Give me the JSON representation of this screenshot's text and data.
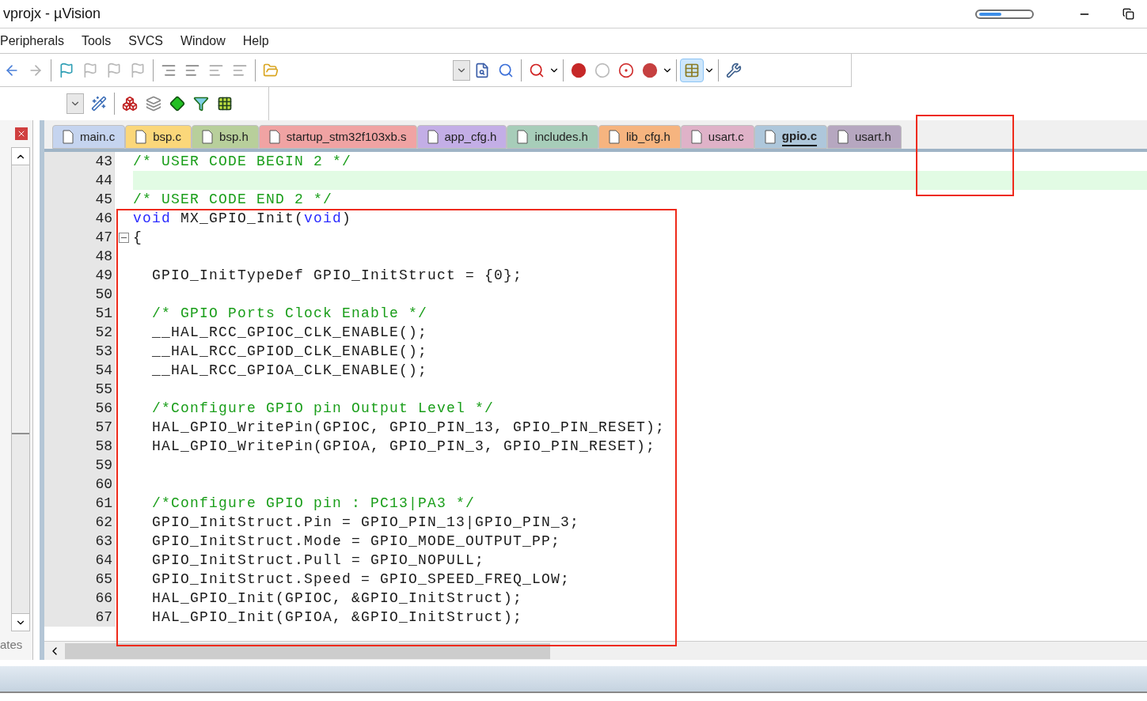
{
  "window": {
    "title": "vprojx - µVision"
  },
  "menu": [
    "Peripherals",
    "Tools",
    "SVCS",
    "Window",
    "Help"
  ],
  "left_panel": {
    "tab": "ates"
  },
  "tabs": [
    {
      "label": "main.c",
      "color": "#c5d4ef",
      "selected": false
    },
    {
      "label": "bsp.c",
      "color": "#fbd77a",
      "selected": false
    },
    {
      "label": "bsp.h",
      "color": "#b8cf9b",
      "selected": false
    },
    {
      "label": "startup_stm32f103xb.s",
      "color": "#f0a3a3",
      "selected": false
    },
    {
      "label": "app_cfg.h",
      "color": "#c3aee6",
      "selected": false
    },
    {
      "label": "includes.h",
      "color": "#a7cdb9",
      "selected": false
    },
    {
      "label": "lib_cfg.h",
      "color": "#f6b47f",
      "selected": false
    },
    {
      "label": "usart.c",
      "color": "#dfb2c8",
      "selected": false
    },
    {
      "label": "gpio.c",
      "color": "#aec7db",
      "selected": true
    },
    {
      "label": "usart.h",
      "color": "#b6a7c0",
      "selected": false
    }
  ],
  "code_lines": [
    {
      "number": "43",
      "highlighted": false,
      "fold": false,
      "segments": [
        {
          "kind": "comment",
          "text": "/* USER CODE BEGIN 2 */"
        }
      ]
    },
    {
      "number": "44",
      "highlighted": true,
      "fold": false
    },
    {
      "number": "45",
      "highlighted": false,
      "fold": false,
      "segments": [
        {
          "kind": "comment",
          "text": "/* USER CODE END 2 */"
        }
      ]
    },
    {
      "number": "46",
      "highlighted": false,
      "fold": false,
      "segments": [
        {
          "kind": "keyword",
          "text": "void"
        },
        {
          "kind": "plain",
          "text": " MX_GPIO_Init("
        },
        {
          "kind": "keyword",
          "text": "void"
        },
        {
          "kind": "plain",
          "text": ")"
        }
      ]
    },
    {
      "number": "47",
      "highlighted": false,
      "fold": true,
      "segments": [
        {
          "kind": "plain",
          "text": "{"
        }
      ]
    },
    {
      "number": "48",
      "highlighted": false,
      "fold": false
    },
    {
      "number": "49",
      "highlighted": false,
      "fold": false,
      "segments": [
        {
          "kind": "plain",
          "text": "  GPIO_InitTypeDef GPIO_InitStruct = {0};"
        }
      ]
    },
    {
      "number": "50",
      "highlighted": false,
      "fold": false
    },
    {
      "number": "51",
      "highlighted": false,
      "fold": false,
      "segments": [
        {
          "kind": "comment",
          "text": "  /* GPIO Ports Clock Enable */"
        }
      ]
    },
    {
      "number": "52",
      "highlighted": false,
      "fold": false,
      "segments": [
        {
          "kind": "plain",
          "text": "  __HAL_RCC_GPIOC_CLK_ENABLE();"
        }
      ]
    },
    {
      "number": "53",
      "highlighted": false,
      "fold": false,
      "segments": [
        {
          "kind": "plain",
          "text": "  __HAL_RCC_GPIOD_CLK_ENABLE();"
        }
      ]
    },
    {
      "number": "54",
      "highlighted": false,
      "fold": false,
      "segments": [
        {
          "kind": "plain",
          "text": "  __HAL_RCC_GPIOA_CLK_ENABLE();"
        }
      ]
    },
    {
      "number": "55",
      "highlighted": false,
      "fold": false
    },
    {
      "number": "56",
      "highlighted": false,
      "fold": false,
      "segments": [
        {
          "kind": "comment",
          "text": "  /*Configure GPIO pin Output Level */"
        }
      ]
    },
    {
      "number": "57",
      "highlighted": false,
      "fold": false,
      "segments": [
        {
          "kind": "plain",
          "text": "  HAL_GPIO_WritePin(GPIOC, GPIO_PIN_13, GPIO_PIN_RESET);"
        }
      ]
    },
    {
      "number": "58",
      "highlighted": false,
      "fold": false,
      "segments": [
        {
          "kind": "plain",
          "text": "  HAL_GPIO_WritePin(GPIOA, GPIO_PIN_3, GPIO_PIN_RESET);"
        }
      ]
    },
    {
      "number": "59",
      "highlighted": false,
      "fold": false
    },
    {
      "number": "60",
      "highlighted": false,
      "fold": false
    },
    {
      "number": "61",
      "highlighted": false,
      "fold": false,
      "segments": [
        {
          "kind": "comment",
          "text": "  /*Configure GPIO pin : PC13|PA3 */"
        }
      ]
    },
    {
      "number": "62",
      "highlighted": false,
      "fold": false,
      "segments": [
        {
          "kind": "plain",
          "text": "  GPIO_InitStruct.Pin = GPIO_PIN_13|GPIO_PIN_3;"
        }
      ]
    },
    {
      "number": "63",
      "highlighted": false,
      "fold": false,
      "segments": [
        {
          "kind": "plain",
          "text": "  GPIO_InitStruct.Mode = GPIO_MODE_OUTPUT_PP;"
        }
      ]
    },
    {
      "number": "64",
      "highlighted": false,
      "fold": false,
      "segments": [
        {
          "kind": "plain",
          "text": "  GPIO_InitStruct.Pull = GPIO_NOPULL;"
        }
      ]
    },
    {
      "number": "65",
      "highlighted": false,
      "fold": false,
      "segments": [
        {
          "kind": "plain",
          "text": "  GPIO_InitStruct.Speed = GPIO_SPEED_FREQ_LOW;"
        }
      ]
    },
    {
      "number": "66",
      "highlighted": false,
      "fold": false,
      "segments": [
        {
          "kind": "plain",
          "text": "  HAL_GPIO_Init(GPIOC, &GPIO_InitStruct);"
        }
      ]
    },
    {
      "number": "67",
      "highlighted": false,
      "fold": false,
      "segments": [
        {
          "kind": "plain",
          "text": "  HAL_GPIO_Init(GPIOA, &GPIO_InitStruct);"
        }
      ]
    }
  ]
}
